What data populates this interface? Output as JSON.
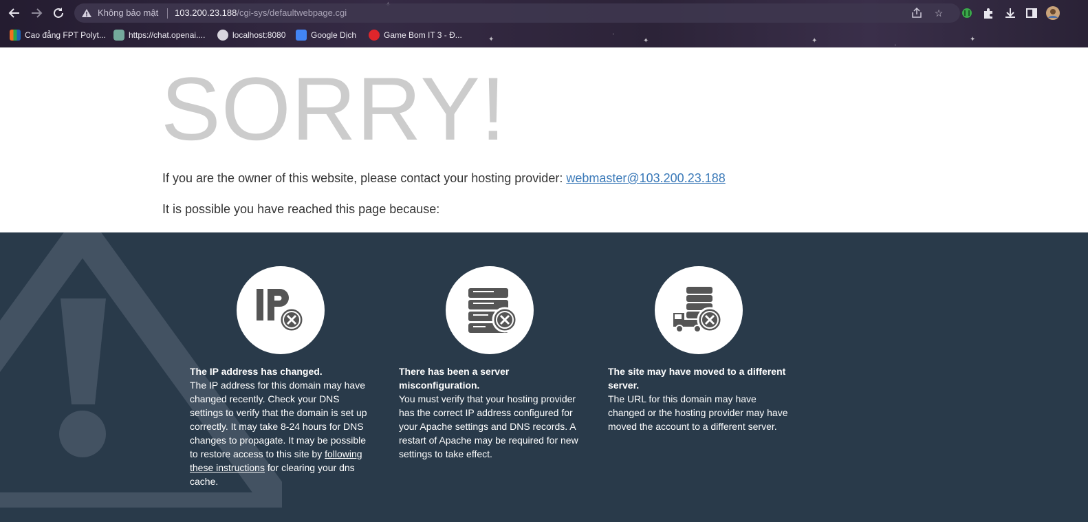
{
  "browser": {
    "security_label": "Không bảo mật",
    "url_host": "103.200.23.188",
    "url_path": "/cgi-sys/defaultwebpage.cgi",
    "bookmarks": [
      {
        "label": "Cao đẳng FPT Polyt..."
      },
      {
        "label": "https://chat.openai...."
      },
      {
        "label": "localhost:8080"
      },
      {
        "label": "Google Dịch"
      },
      {
        "label": "Game Bom IT 3 - Đ..."
      }
    ]
  },
  "page": {
    "heading": "SORRY!",
    "contact_text": "If you are the owner of this website, please contact your hosting provider: ",
    "contact_link": "webmaster@103.200.23.188",
    "because_text": "It is possible you have reached this page because:"
  },
  "reasons": [
    {
      "icon": "ip-error-icon",
      "title": "The IP address has changed.",
      "body_before": "The IP address for this domain may have changed recently. Check your DNS settings to verify that the domain is set up correctly. It may take 8-24 hours for DNS changes to propagate. It may be possible to restore access to this site by ",
      "link": "following these instructions",
      "body_after": " for clearing your dns cache."
    },
    {
      "icon": "server-error-icon",
      "title": "There has been a server misconfiguration.",
      "body_before": "You must verify that your hosting provider has the correct IP address configured for your Apache settings and DNS records. A restart of Apache may be required for new settings to take effect."
    },
    {
      "icon": "server-moved-icon",
      "title": "The site may have moved to a different server.",
      "body_before": "The URL for this domain may have changed or the hosting provider may have moved the account to a different server."
    }
  ],
  "colors": {
    "reasons_bg": "#293a4a",
    "heading": "#cccccc",
    "link": "#3a79b8"
  }
}
